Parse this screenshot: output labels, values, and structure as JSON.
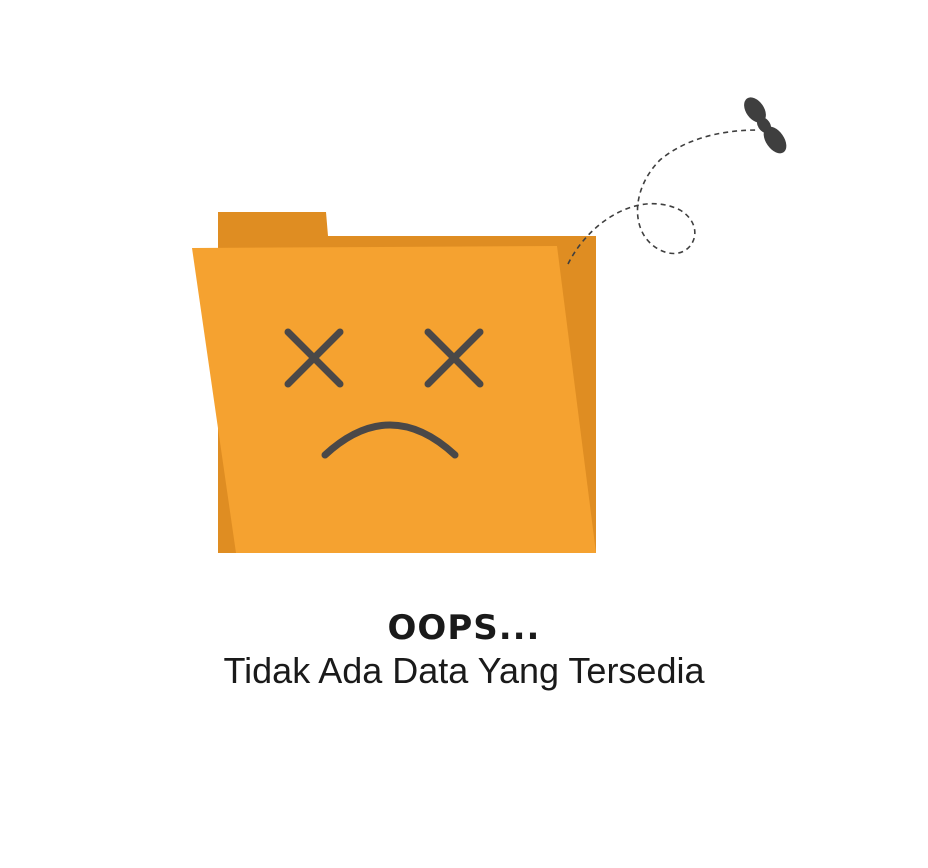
{
  "empty_state": {
    "title": "OOPS...",
    "message": "Tidak Ada Data Yang Tersedia"
  },
  "colors": {
    "folder_front": "#F5A230",
    "folder_back": "#DF8D22",
    "face": "#4A4848",
    "fly": "#3F3F3F",
    "text": "#1A1A1A"
  },
  "icons": {
    "illustration": "sad-folder-icon",
    "eyes": "x-eyes-icon",
    "mouth": "frown-icon",
    "fly": "fly-icon"
  }
}
